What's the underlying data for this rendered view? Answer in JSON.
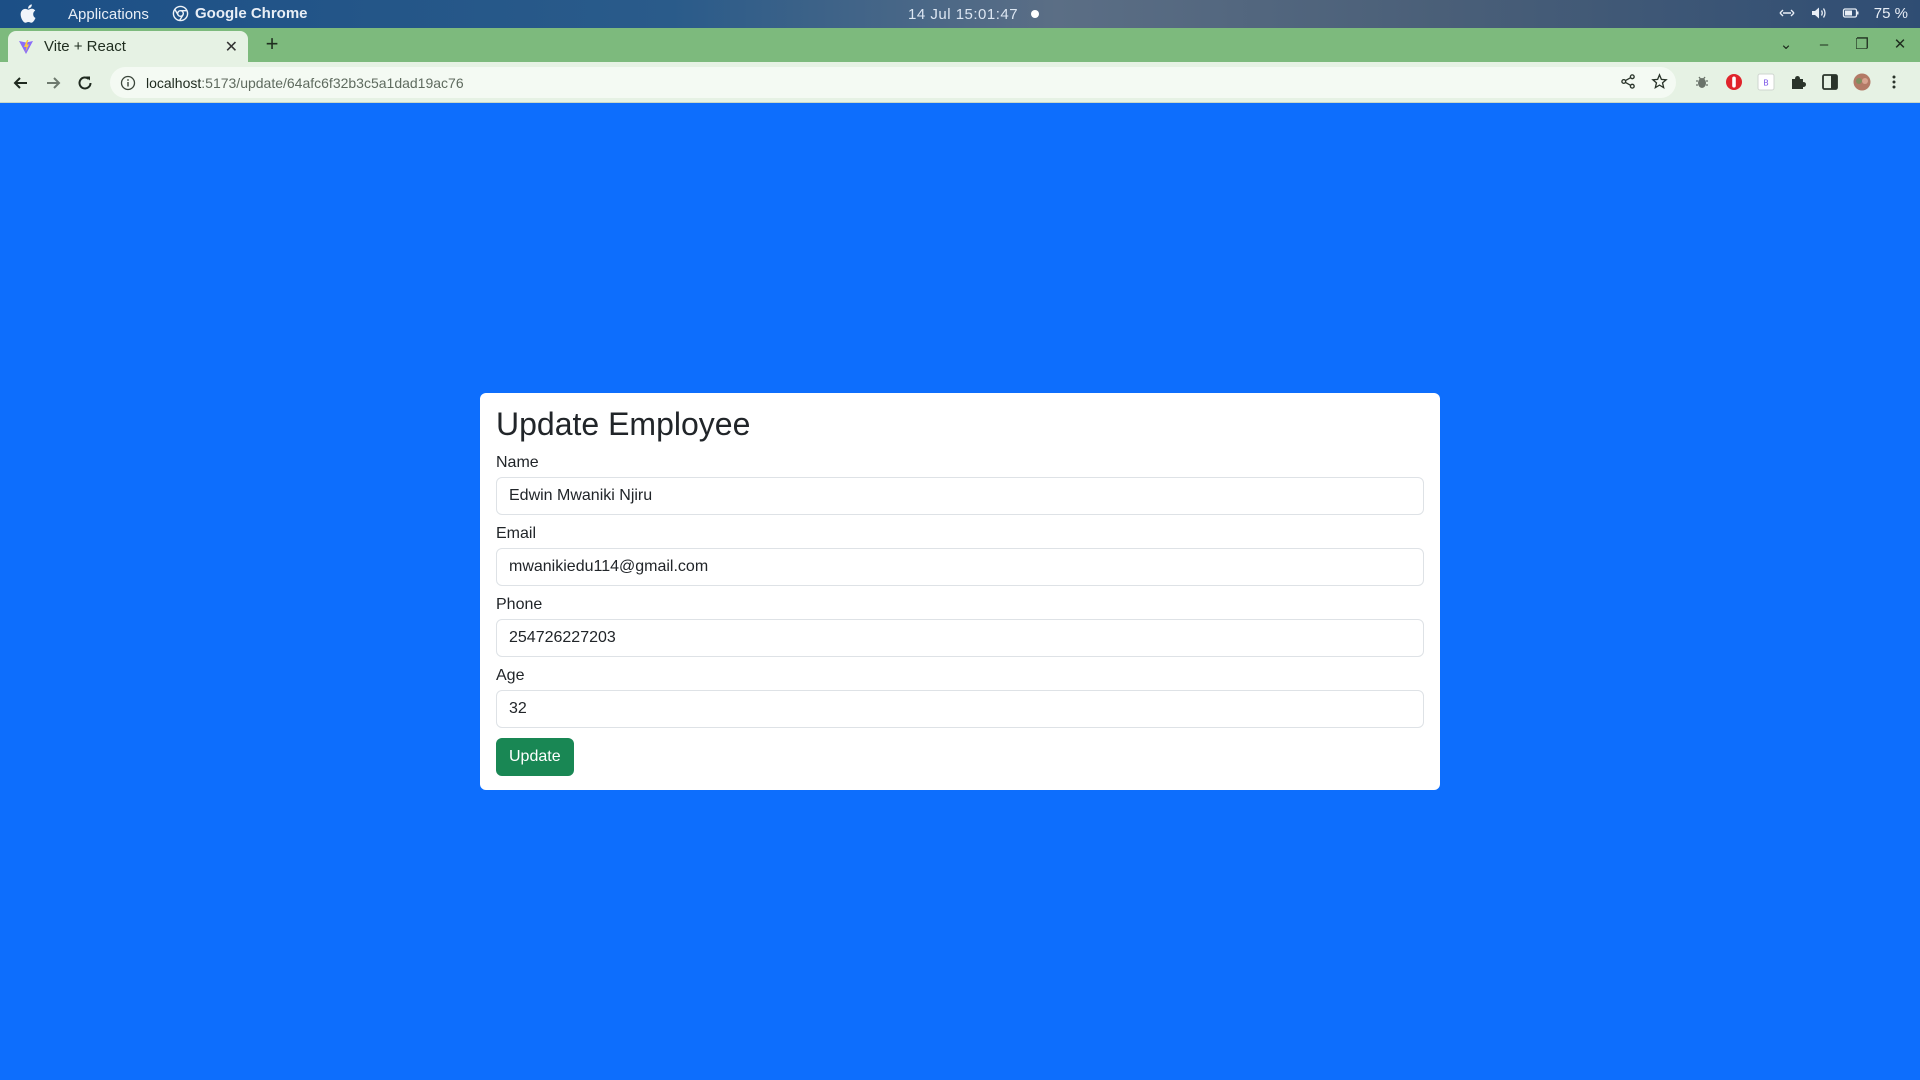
{
  "os_bar": {
    "applications_label": "Applications",
    "active_app": "Google Chrome",
    "clock": "14 Jul  15:01:47",
    "battery": "75 %"
  },
  "browser": {
    "tab_title": "Vite + React",
    "url_host": "localhost",
    "url_path": ":5173/update/64afc6f32b3c5a1dad19ac76"
  },
  "form": {
    "title": "Update Employee",
    "fields": [
      {
        "label": "Name",
        "value": "Edwin Mwaniki Njiru"
      },
      {
        "label": "Email",
        "value": "mwanikiedu114@gmail.com"
      },
      {
        "label": "Phone",
        "value": "254726227203"
      },
      {
        "label": "Age",
        "value": "32"
      }
    ],
    "submit_label": "Update"
  },
  "colors": {
    "page_background": "#0d6efd",
    "submit_button": "#198754",
    "tab_strip": "#7dba7d"
  }
}
